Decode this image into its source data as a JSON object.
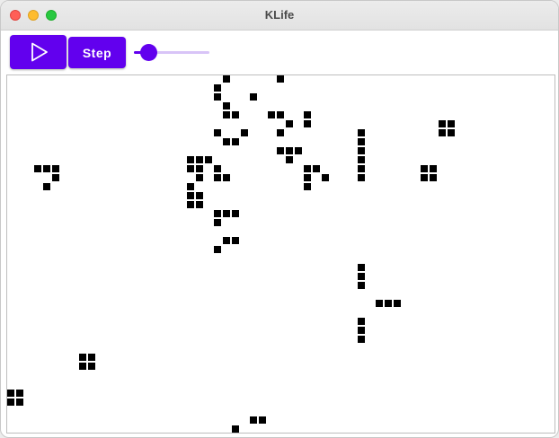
{
  "window": {
    "title": "KLife"
  },
  "toolbar": {
    "play_icon": "play-icon",
    "step_label": "Step",
    "speed_level": 0.2
  },
  "colors": {
    "accent": "#6200ee",
    "track": "#d8c4f7",
    "cell": "#000000"
  },
  "board": {
    "live_cells": [
      [
        24,
        0
      ],
      [
        30,
        0
      ],
      [
        23,
        1
      ],
      [
        23,
        2
      ],
      [
        27,
        2
      ],
      [
        24,
        3
      ],
      [
        24,
        4
      ],
      [
        25,
        4
      ],
      [
        29,
        4
      ],
      [
        30,
        4
      ],
      [
        33,
        4
      ],
      [
        31,
        5
      ],
      [
        33,
        5
      ],
      [
        23,
        6
      ],
      [
        26,
        6
      ],
      [
        30,
        6
      ],
      [
        39,
        6
      ],
      [
        48,
        5
      ],
      [
        49,
        5
      ],
      [
        48,
        6
      ],
      [
        49,
        6
      ],
      [
        24,
        7
      ],
      [
        25,
        7
      ],
      [
        39,
        7
      ],
      [
        30,
        8
      ],
      [
        31,
        8
      ],
      [
        32,
        8
      ],
      [
        39,
        8
      ],
      [
        20,
        9
      ],
      [
        21,
        9
      ],
      [
        22,
        9
      ],
      [
        31,
        9
      ],
      [
        39,
        9
      ],
      [
        3,
        10
      ],
      [
        4,
        10
      ],
      [
        5,
        10
      ],
      [
        20,
        10
      ],
      [
        21,
        10
      ],
      [
        23,
        10
      ],
      [
        33,
        10
      ],
      [
        34,
        10
      ],
      [
        39,
        10
      ],
      [
        46,
        10
      ],
      [
        47,
        10
      ],
      [
        5,
        11
      ],
      [
        21,
        11
      ],
      [
        23,
        11
      ],
      [
        24,
        11
      ],
      [
        33,
        11
      ],
      [
        35,
        11
      ],
      [
        39,
        11
      ],
      [
        46,
        11
      ],
      [
        47,
        11
      ],
      [
        4,
        12
      ],
      [
        20,
        12
      ],
      [
        33,
        12
      ],
      [
        20,
        13
      ],
      [
        21,
        13
      ],
      [
        20,
        14
      ],
      [
        21,
        14
      ],
      [
        23,
        15
      ],
      [
        24,
        15
      ],
      [
        25,
        15
      ],
      [
        23,
        16
      ],
      [
        24,
        18
      ],
      [
        25,
        18
      ],
      [
        23,
        19
      ],
      [
        39,
        21
      ],
      [
        39,
        22
      ],
      [
        39,
        23
      ],
      [
        41,
        25
      ],
      [
        42,
        25
      ],
      [
        43,
        25
      ],
      [
        39,
        27
      ],
      [
        39,
        28
      ],
      [
        39,
        29
      ],
      [
        8,
        31
      ],
      [
        9,
        31
      ],
      [
        8,
        32
      ],
      [
        9,
        32
      ],
      [
        0,
        35
      ],
      [
        1,
        35
      ],
      [
        0,
        36
      ],
      [
        1,
        36
      ],
      [
        27,
        38
      ],
      [
        28,
        38
      ],
      [
        25,
        39
      ]
    ]
  }
}
